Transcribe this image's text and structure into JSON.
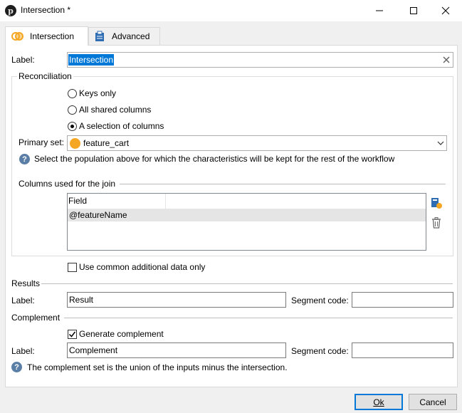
{
  "window": {
    "title": "Intersection *",
    "app_icon_glyph": "p"
  },
  "tabs": [
    {
      "label": "Intersection",
      "icon": "intersection-icon",
      "active": true
    },
    {
      "label": "Advanced",
      "icon": "clipboard-icon",
      "active": false
    }
  ],
  "label_field": {
    "label": "Label:",
    "value": "Intersection"
  },
  "reconciliation": {
    "title": "Reconciliation",
    "options": [
      {
        "label": "Keys only",
        "selected": false
      },
      {
        "label": "All shared columns",
        "selected": false
      },
      {
        "label": "A selection of columns",
        "selected": true
      }
    ],
    "primary_set": {
      "label": "Primary set:",
      "value": "feature_cart",
      "dot_color": "#f5a623"
    },
    "help_text": "Select the population above for which the characteristics will be kept for the rest of the workflow",
    "columns": {
      "title": "Columns used for the join",
      "header": "Field",
      "rows": [
        "@featureName"
      ]
    }
  },
  "common_data": {
    "label": "Use common additional data only",
    "checked": false
  },
  "results": {
    "title": "Results",
    "label_label": "Label:",
    "label_value": "Result",
    "segment_label": "Segment code:",
    "segment_value": ""
  },
  "complement": {
    "title": "Complement",
    "generate_label": "Generate complement",
    "generate_checked": true,
    "label_label": "Label:",
    "label_value": "Complement",
    "segment_label": "Segment code:",
    "segment_value": "",
    "help_text": "The complement set is the union of the inputs minus the intersection."
  },
  "buttons": {
    "ok": "Ok",
    "cancel": "Cancel"
  },
  "colors": {
    "selection": "#0078d7",
    "accent_orange": "#f5a623",
    "help_blue": "#5a7ea6"
  }
}
